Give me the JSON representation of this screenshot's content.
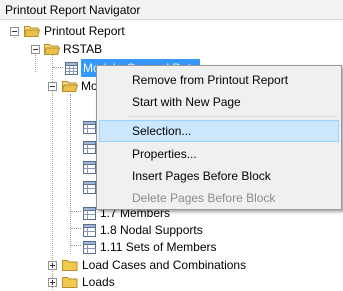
{
  "window": {
    "title": "Printout Report Navigator"
  },
  "tree": {
    "root": {
      "label": "Printout Report"
    },
    "rstab": {
      "label": "RSTAB"
    },
    "model_general_data": {
      "label": "Model - General Data"
    },
    "model_folder": {
      "label": "Mo"
    },
    "members": {
      "label": "1.7 Members"
    },
    "nodal_supports": {
      "label": "1.8 Nodal Supports"
    },
    "sets_of_members": {
      "label": "1.11 Sets of Members"
    },
    "load_cases": {
      "label": "Load Cases and Combinations"
    },
    "loads": {
      "label": "Loads"
    }
  },
  "context_menu": {
    "items": [
      {
        "label": "Remove from Printout Report",
        "enabled": true
      },
      {
        "label": "Start with New Page",
        "enabled": true
      },
      {
        "label": "Selection...",
        "enabled": true,
        "highlighted": true
      },
      {
        "label": "Properties...",
        "enabled": true
      },
      {
        "label": "Insert Pages Before Block",
        "enabled": true
      },
      {
        "label": "Delete Pages Before Block",
        "enabled": false
      }
    ]
  },
  "colors": {
    "selection": "#3399ff",
    "menu_hover": "#cce8ff",
    "folder": "#e8c04a"
  }
}
